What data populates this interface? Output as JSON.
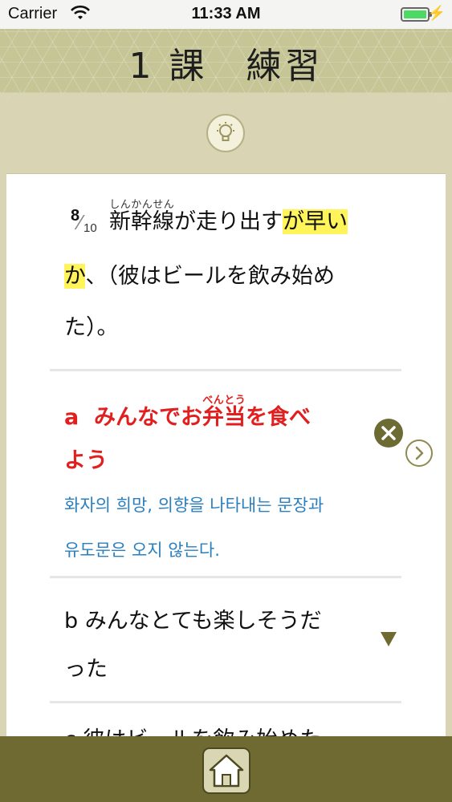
{
  "status_bar": {
    "carrier": "Carrier",
    "time": "11:33 AM"
  },
  "header": {
    "title": "1 課　練習"
  },
  "question": {
    "number": "8",
    "total": "10",
    "line1_plain": "新幹線が走り出す",
    "line1_ruby_base": "新幹線",
    "line1_ruby": "しんかんせん",
    "line1_rest": "が走り出す",
    "line1_highlight": "が早い",
    "line2_highlight": "か",
    "line2_rest": "、（彼はビールを飲み始め",
    "line3": "た）。"
  },
  "option_a": {
    "letter": "a",
    "line1_pre": "みんなでお",
    "ruby_base": "弁当",
    "ruby": "べんとう",
    "line1_post": "を食べ",
    "line2": "よう",
    "explanation_line1": "화자의 희망, 의향을 나타내는 문장과",
    "explanation_line2": "유도문은 오지 않는다."
  },
  "option_b": {
    "letter": "b",
    "line1": "みんなとても楽しそうだ",
    "line2": "った"
  },
  "option_c": {
    "text": "c 彼はビールを飲み始めた"
  },
  "icons": {
    "hint": "lightbulb-icon",
    "wrong": "close-icon",
    "next": "chevron-right-icon",
    "expand": "triangle-down-icon",
    "home": "home-icon"
  },
  "colors": {
    "highlight": "#fff55a",
    "answer_red": "#e21f1f",
    "explanation_blue": "#2a7fbf",
    "olive": "#6f6a32"
  }
}
